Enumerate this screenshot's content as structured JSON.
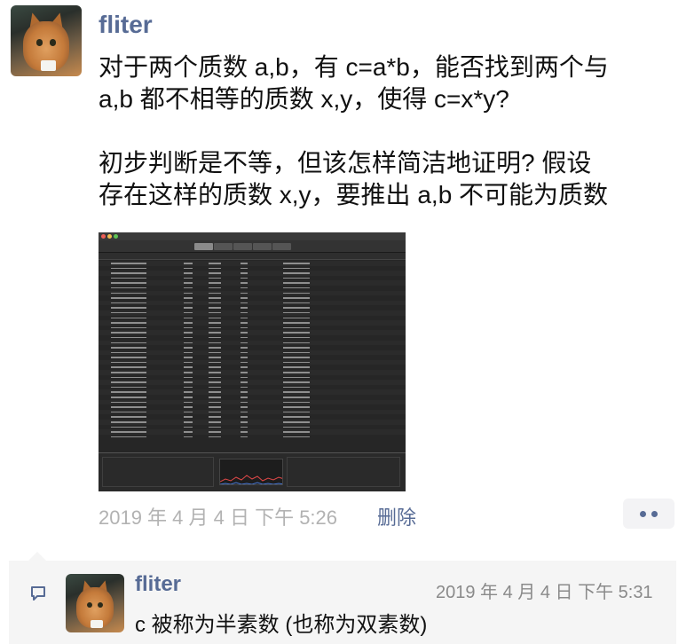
{
  "post": {
    "author": "fliter",
    "text_lines": [
      "对于两个质数 a,b，有 c=a*b，能否找到两个与",
      "a,b 都不相等的质数 x,y，使得 c=x*y?",
      "初步判断是不等，但该怎样简洁地证明? 假设",
      "存在这样的质数 x,y，要推出 a,b 不可能为质数"
    ],
    "timestamp": "2019 年 4 月 4 日  下午 5:26",
    "delete_label": "删除"
  },
  "comment": {
    "author": "fliter",
    "timestamp": "2019 年 4 月 4 日  下午 5:31",
    "text": "c 被称为半素数 (也称为双素数)"
  },
  "icons": {
    "avatar": "cat-avatar",
    "more": "more-dots-icon",
    "comment": "comment-bubble-icon"
  },
  "colors": {
    "link": "#576b95",
    "meta": "#b2b2b2",
    "comment_bg": "#f5f5f5"
  }
}
